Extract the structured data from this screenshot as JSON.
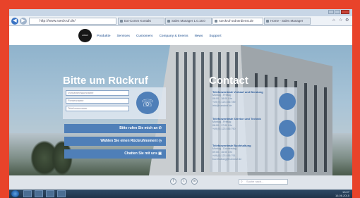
{
  "browser": {
    "url": "http://www.rueckruf.de/",
    "tabs": [
      "Ext-Comm Kontakt",
      "Sales Manager 1.0.18.0",
      "rueckruf-ordnerdienst.de",
      "Home - Sales Manager"
    ],
    "active_tab": 2,
    "icons": [
      "home-icon",
      "star-icon",
      "gear-icon"
    ]
  },
  "site": {
    "logo_text": "LOGO",
    "nav": [
      "Produkte",
      "Services",
      "Customers",
      "Company & Events",
      "News",
      "Support"
    ]
  },
  "callback": {
    "heading": "Bitte um Rückruf",
    "fields": [
      "Vorname/Nachname",
      "Firmenname",
      "Telefonnummer"
    ],
    "buttons": [
      "Bitte rufen Sie mich an ✆",
      "Wählen Sie einen Rückrufmoment ◷",
      "Chatten Sie mit uns ▣"
    ],
    "phone_icon": "☏"
  },
  "contact": {
    "heading": "Contact",
    "entries": [
      {
        "name": "Telefonzentrale Verkauf und Beratung",
        "lines": [
          "Montag - Freitag",
          "08:00 - 18:00 Uhr",
          "+49 (0) 123 456 789",
          "info@rueckruf.de"
        ]
      },
      {
        "name": "Telefonzentrale Service und Technik",
        "lines": [
          "Montag - Freitag",
          "08:00 - 17:00 Uhr",
          "+49 (0) 123 456 790"
        ]
      },
      {
        "name": "Telefonzentrale Buchhaltung",
        "lines": [
          "Montag - Donnerstag",
          "09:00 - 16:00 Uhr",
          "+49 (0) 123 456 791",
          "buchhaltung@rueckruf.de"
        ]
      }
    ]
  },
  "footer": {
    "social": [
      "f",
      "t",
      "in"
    ],
    "search_placeholder": "Suche nach..."
  },
  "taskbar": {
    "time": "13:07",
    "date": "16.06.2015"
  }
}
